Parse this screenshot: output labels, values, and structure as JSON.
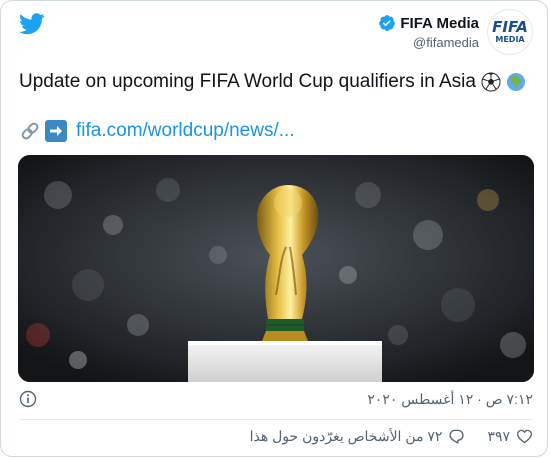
{
  "author": {
    "name": "FIFA Media",
    "handle": "@fifamedia",
    "avatar_top": "FIFA",
    "avatar_bottom": "MEDIA"
  },
  "tweet": {
    "text": "Update on upcoming FIFA World Cup qualifiers in Asia",
    "emojis": [
      "soccer-ball-icon",
      "globe-asia-icon"
    ],
    "link_text": "fifa.com/worldcup/news/..."
  },
  "meta": {
    "timestamp": "٧:١٢ ص · ١٢ أغسطس ٢٠٢٠"
  },
  "actions": {
    "like_count": "٣٩٧",
    "reply_text": "٧٢ من الأشخاص يغرّدون حول هذا"
  },
  "colors": {
    "brand_blue": "#1da1f2",
    "link": "#1b95e0",
    "muted": "#536471",
    "fifa_blue": "#1a4e8c"
  }
}
